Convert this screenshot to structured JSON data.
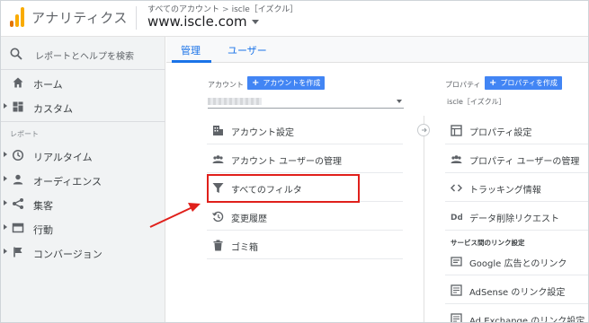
{
  "header": {
    "app_title": "アナリティクス",
    "breadcrumb": [
      "すべてのアカウント",
      "iscle［イズクル］"
    ],
    "breadcrumb_separator": ">",
    "property_name": "www.iscle.com"
  },
  "sidebar": {
    "search_label": "レポートとヘルプを検索",
    "top_items": [
      {
        "label": "ホーム",
        "icon": "home-icon"
      },
      {
        "label": "カスタム",
        "icon": "dashboard-grid-icon"
      }
    ],
    "section_label": "レポート",
    "report_items": [
      {
        "label": "リアルタイム",
        "icon": "clock-icon"
      },
      {
        "label": "オーディエンス",
        "icon": "person-icon"
      },
      {
        "label": "集客",
        "icon": "acquisition-icon"
      },
      {
        "label": "行動",
        "icon": "behavior-window-icon"
      },
      {
        "label": "コンバージョン",
        "icon": "flag-icon"
      }
    ]
  },
  "tabs": [
    {
      "label": "管理",
      "active": true
    },
    {
      "label": "ユーザー",
      "active": false
    }
  ],
  "account_column": {
    "heading": "アカウント",
    "create_button": "アカウントを作成",
    "items": [
      {
        "label": "アカウント設定",
        "icon": "building-icon"
      },
      {
        "label": "アカウント ユーザーの管理",
        "icon": "people-icon"
      },
      {
        "label": "すべてのフィルタ",
        "icon": "filter-icon"
      },
      {
        "label": "変更履歴",
        "icon": "history-icon"
      },
      {
        "label": "ゴミ箱",
        "icon": "trash-icon"
      }
    ]
  },
  "property_column": {
    "heading": "プロパティ",
    "create_button": "プロパティを作成",
    "selected_property": "iscle［イズクル］",
    "items": [
      {
        "label": "プロパティ設定",
        "icon": "window-icon"
      },
      {
        "label": "プロパティ ユーザーの管理",
        "icon": "people-icon"
      },
      {
        "label": "トラッキング情報",
        "icon": "code-icon"
      },
      {
        "label": "データ削除リクエスト",
        "icon": "dd-icon"
      }
    ],
    "subsection_heading": "サービス間のリンク設定",
    "link_items": [
      {
        "label": "Google 広告とのリンク",
        "icon": "ads-link-icon"
      },
      {
        "label": "AdSense のリンク設定",
        "icon": "adsense-link-icon"
      },
      {
        "label": "Ad Exchange のリンク設定",
        "icon": "adx-link-icon"
      }
    ]
  },
  "colors": {
    "accent": "#1a73e8",
    "button": "#4285f4",
    "annotation": "#e0201b"
  }
}
